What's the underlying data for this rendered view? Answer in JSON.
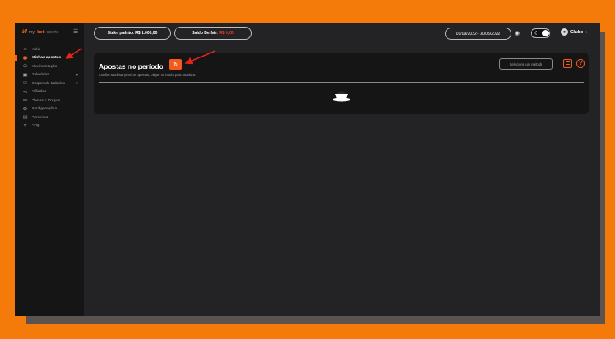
{
  "brand": {
    "mark": "M",
    "my": "my",
    "bet": "bet",
    "sports": "sports"
  },
  "sidebar": {
    "items": [
      {
        "label": "Início",
        "icon": "home-icon",
        "glyph": "⌂",
        "active": false,
        "chevron": false
      },
      {
        "label": "Minhas apostas",
        "icon": "coin-icon",
        "glyph": "◉",
        "active": true,
        "chevron": false
      },
      {
        "label": "Movimentação",
        "icon": "transfer-icon",
        "glyph": "⊙",
        "active": false,
        "chevron": false
      },
      {
        "label": "Relatórios",
        "icon": "report-icon",
        "glyph": "▣",
        "active": false,
        "chevron": true
      },
      {
        "label": "Grupos de trabalho",
        "icon": "group-icon",
        "glyph": "⚇",
        "active": false,
        "chevron": true
      },
      {
        "label": "Afiliados",
        "icon": "share-icon",
        "glyph": "⋖",
        "active": false,
        "chevron": false
      },
      {
        "label": "Planos e Preços",
        "icon": "plan-icon",
        "glyph": "▭",
        "active": false,
        "chevron": false
      },
      {
        "label": "Configurações",
        "icon": "gear-icon",
        "glyph": "⚙",
        "active": false,
        "chevron": false
      },
      {
        "label": "Parceiros",
        "icon": "partners-icon",
        "glyph": "▤",
        "active": false,
        "chevron": false
      },
      {
        "label": "FAQ",
        "icon": "question-icon",
        "glyph": "?",
        "active": false,
        "chevron": false
      }
    ]
  },
  "topbar": {
    "stake_label": "Stake padrão:",
    "stake_value": "R$ 1.000,00",
    "balance_label": "Saldo Betfair:",
    "balance_value": "R$ 0,00",
    "date_range": "01/09/2022 - 30/09/2022",
    "user_name": "Clube"
  },
  "card": {
    "title": "Apostas no período",
    "subtitle": "Confira sua lista geral de apostas, clique no botão para atualizar.",
    "method_placeholder": "Selecione um método"
  },
  "colors": {
    "accent": "#f26522",
    "annotation_arrow": "#e8231a",
    "frame": "#f47a0a"
  }
}
